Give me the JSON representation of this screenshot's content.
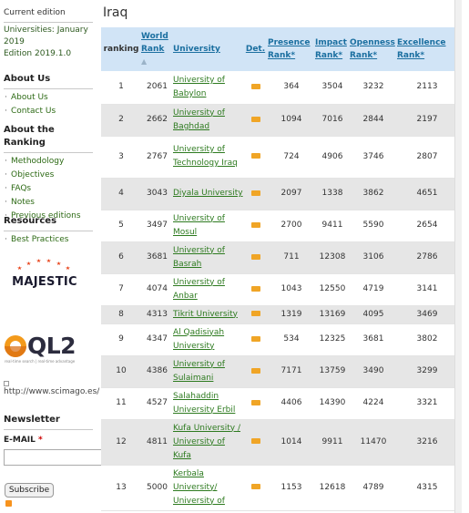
{
  "sidebar": {
    "current_edition_title": "Current edition",
    "edition_line1": "Universities: January",
    "edition_line2": "2019",
    "edition_line3": "Edition 2019.1.0",
    "about_us_title": "About Us",
    "about_us_items": [
      "About Us",
      "Contact Us"
    ],
    "about_ranking_title": "About the Ranking",
    "about_ranking_items": [
      "Methodology",
      "Objectives",
      "FAQs",
      "Notes",
      "Previous editions"
    ],
    "resources_title": "Resources",
    "resources_items": [
      "Best Practices"
    ],
    "majestic_logo": "MAJESTIC",
    "ql2_logo": "QL2",
    "ql2_tagline": "real-time search | real-time advantage",
    "scimago_link": "http://www.scimago.es/",
    "newsletter_title": "Newsletter",
    "email_label": "E-MAIL",
    "email_required": "*",
    "email_value": "",
    "subscribe_label": "Subscribe"
  },
  "main": {
    "country_title": "Iraq",
    "columns": {
      "ranking": "ranking",
      "world_rank_l1": "World",
      "world_rank_l2": "Rank",
      "sort_arrow": "▲",
      "university": "University",
      "det": "Det.",
      "presence_l1": "Presence",
      "presence_l2": "Rank*",
      "impact_l1": "Impact",
      "impact_l2": "Rank*",
      "openness_l1": "Openness",
      "openness_l2": "Rank*",
      "excellence_l1": "Excellence",
      "excellence_l2": "Rank*"
    },
    "rows": [
      {
        "rank": "1",
        "world": "2061",
        "uni": "University of Babylon",
        "presence": "364",
        "impact": "3504",
        "openness": "3232",
        "excellence": "2113"
      },
      {
        "rank": "2",
        "world": "2662",
        "uni": "University of Baghdad",
        "presence": "1094",
        "impact": "7016",
        "openness": "2844",
        "excellence": "2197"
      },
      {
        "rank": "3",
        "world": "2767",
        "uni": "University of Technology Iraq",
        "presence": "724",
        "impact": "4906",
        "openness": "3746",
        "excellence": "2807"
      },
      {
        "rank": "4",
        "world": "3043",
        "uni": "Diyala University",
        "presence": "2097",
        "impact": "1338",
        "openness": "3862",
        "excellence": "4651"
      },
      {
        "rank": "5",
        "world": "3497",
        "uni": "University of Mosul",
        "presence": "2700",
        "impact": "9411",
        "openness": "5590",
        "excellence": "2654"
      },
      {
        "rank": "6",
        "world": "3681",
        "uni": "University of Basrah",
        "presence": "711",
        "impact": "12308",
        "openness": "3106",
        "excellence": "2786"
      },
      {
        "rank": "7",
        "world": "4074",
        "uni": "University of Anbar",
        "presence": "1043",
        "impact": "12550",
        "openness": "4719",
        "excellence": "3141"
      },
      {
        "rank": "8",
        "world": "4313",
        "uni": "Tikrit University",
        "presence": "1319",
        "impact": "13169",
        "openness": "4095",
        "excellence": "3469"
      },
      {
        "rank": "9",
        "world": "4347",
        "uni": "Al Qadisiyah University",
        "presence": "534",
        "impact": "12325",
        "openness": "3681",
        "excellence": "3802"
      },
      {
        "rank": "10",
        "world": "4386",
        "uni": "University of Sulaimani",
        "presence": "7171",
        "impact": "13759",
        "openness": "3490",
        "excellence": "3299"
      },
      {
        "rank": "11",
        "world": "4527",
        "uni": "Salahaddin University Erbil",
        "presence": "4406",
        "impact": "14390",
        "openness": "4224",
        "excellence": "3321"
      },
      {
        "rank": "12",
        "world": "4811",
        "uni": "Kufa University / University of Kufa",
        "presence": "1014",
        "impact": "9911",
        "openness": "11470",
        "excellence": "3216"
      },
      {
        "rank": "13",
        "world": "5000",
        "uni": "Kerbala University/ University of",
        "presence": "1153",
        "impact": "12618",
        "openness": "4789",
        "excellence": "4315"
      }
    ]
  },
  "colors": {
    "header_bg": "#d1e4f6",
    "header_link": "#1b6fa0",
    "uni_link": "#2d7a1f",
    "row_alt": "#e6e6e6",
    "det_icon": "#f0a526",
    "majestic_star": "#e8431a",
    "ql2_orange": "#f39a1b"
  },
  "icons": {
    "det": "details-icon",
    "rss": "rss-icon"
  }
}
